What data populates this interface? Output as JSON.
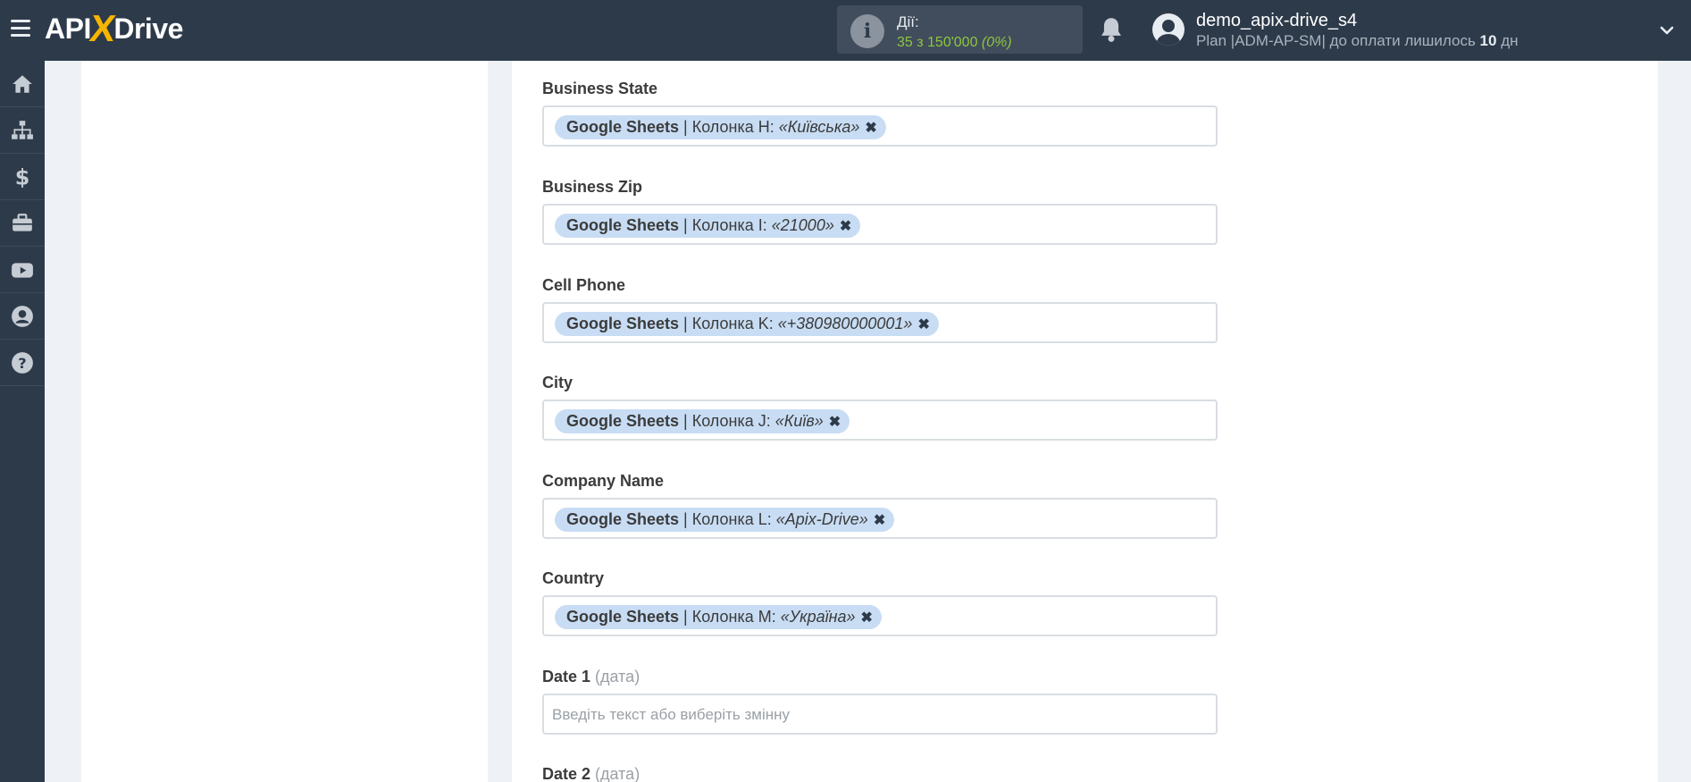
{
  "header": {
    "logo": {
      "left": "API",
      "x": "X",
      "right": "Drive"
    },
    "actions_label": "Дії:",
    "actions_value": "35 з 150'000",
    "actions_percent": "(0%)",
    "user_name": "demo_apix-drive_s4",
    "plan_prefix": "Plan |ADM-AP-SM| до оплати лишилось ",
    "plan_days": "10",
    "plan_suffix": " дн"
  },
  "sidebar": {
    "items": [
      {
        "icon": "home-icon"
      },
      {
        "icon": "sitemap-icon"
      },
      {
        "icon": "dollar-icon"
      },
      {
        "icon": "briefcase-icon"
      },
      {
        "icon": "youtube-icon"
      },
      {
        "icon": "user-circle-icon"
      },
      {
        "icon": "help-icon"
      }
    ]
  },
  "fields": [
    {
      "label": "Business State",
      "hint": "",
      "tag": {
        "service": "Google Sheets",
        "column": " | Колонка H: ",
        "value": "«Київська»",
        "remove": "✖"
      }
    },
    {
      "label": "Business Zip",
      "hint": "",
      "tag": {
        "service": "Google Sheets",
        "column": " | Колонка I: ",
        "value": "«21000»",
        "remove": "✖"
      }
    },
    {
      "label": "Cell Phone",
      "hint": "",
      "tag": {
        "service": "Google Sheets",
        "column": " | Колонка K: ",
        "value": "«+380980000001»",
        "remove": "✖"
      }
    },
    {
      "label": "City",
      "hint": "",
      "tag": {
        "service": "Google Sheets",
        "column": " | Колонка J: ",
        "value": "«Київ»",
        "remove": "✖"
      }
    },
    {
      "label": "Company Name",
      "hint": "",
      "tag": {
        "service": "Google Sheets",
        "column": " | Колонка L: ",
        "value": "«Apix-Drive»",
        "remove": "✖"
      }
    },
    {
      "label": "Country",
      "hint": "",
      "tag": {
        "service": "Google Sheets",
        "column": " | Колонка M: ",
        "value": "«Україна»",
        "remove": "✖"
      }
    },
    {
      "label": "Date 1",
      "hint": " (дата)",
      "placeholder": "Введіть текст або виберіть змінну"
    },
    {
      "label": "Date 2",
      "hint": " (дата)"
    }
  ]
}
